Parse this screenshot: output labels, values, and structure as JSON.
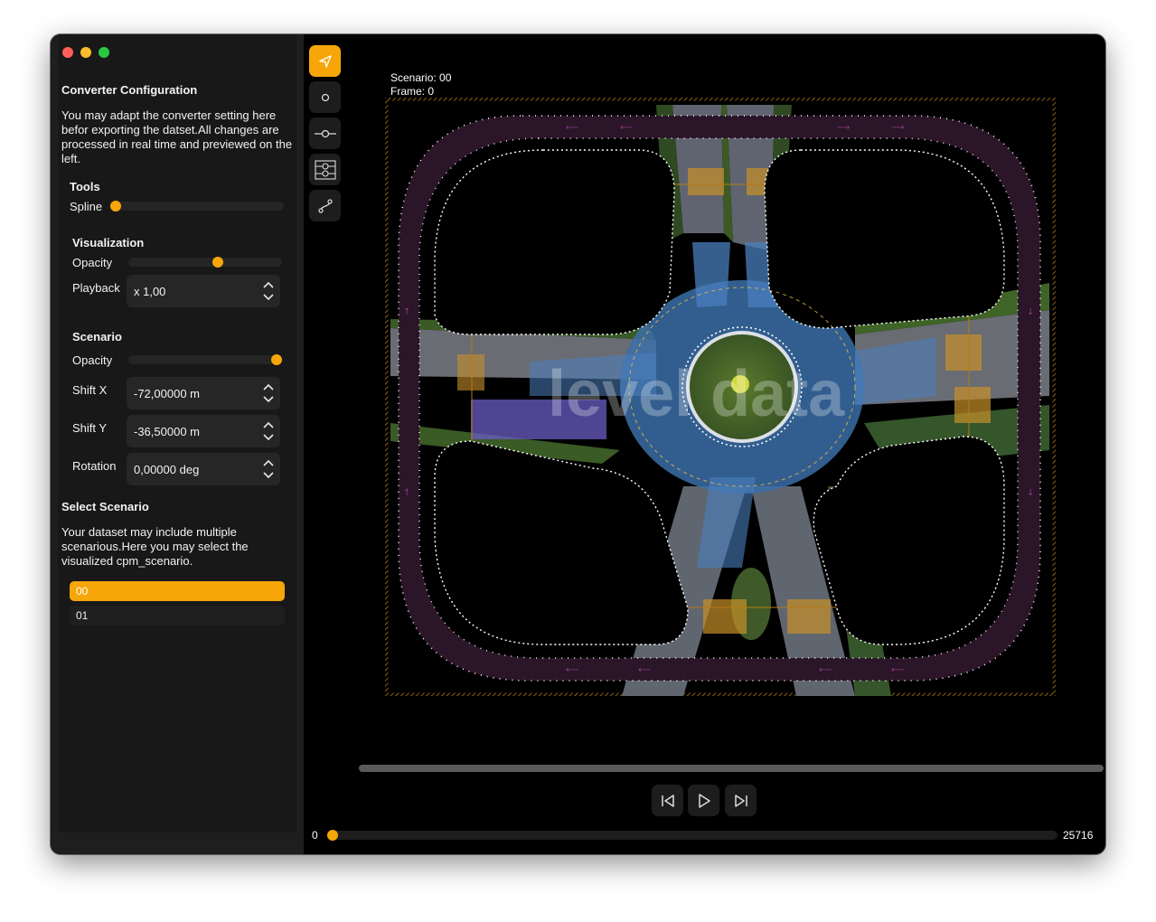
{
  "window": {
    "traffic_lights": [
      "close",
      "minimize",
      "zoom"
    ]
  },
  "sidebar": {
    "title": "Converter Configuration",
    "description": "You may adapt the converter setting here befor exporting the datset.All changes are processed in real time and previewed on the left.",
    "tools": {
      "heading": "Tools",
      "spline_label": "Spline",
      "spline_value": 0
    },
    "visualization": {
      "heading": "Visualization",
      "opacity_label": "Opacity",
      "opacity_value": 0.6,
      "playback_label": "Playback",
      "playback_value": "x 1,00"
    },
    "scenario": {
      "heading": "Scenario",
      "opacity_label": "Opacity",
      "opacity_value": 1.0,
      "shift_x_label": "Shift X",
      "shift_x_value": "-72,00000 m",
      "shift_y_label": "Shift Y",
      "shift_y_value": "-36,50000 m",
      "rotation_label": "Rotation",
      "rotation_value": "0,00000 deg"
    },
    "select_scenario": {
      "heading": "Select Scenario",
      "description": "Your dataset may include multiple scenarious.Here you may select the visualized cpm_scenario.",
      "items": [
        "00",
        "01"
      ],
      "selected": "00"
    }
  },
  "toolbar": {
    "tools": [
      "pointer-icon",
      "circle-node-icon",
      "line-node-icon",
      "multi-line-node-icon",
      "spline-path-icon"
    ],
    "active": "pointer-icon"
  },
  "canvas": {
    "scenario_label": "Scenario: 00",
    "frame_label": "Frame: 0",
    "watermark": "level data"
  },
  "playback": {
    "buttons": [
      "skip-back-icon",
      "play-icon",
      "skip-forward-icon"
    ],
    "frame_start": "0",
    "frame_end": "25716",
    "frame_position": 0
  },
  "colors": {
    "accent": "#f6a609",
    "sidebar_bg": "#1e1e1e",
    "track_lane": "#2b1528",
    "lane_blue": "#3b7bd6",
    "lane_purple": "#6b2a6b"
  }
}
